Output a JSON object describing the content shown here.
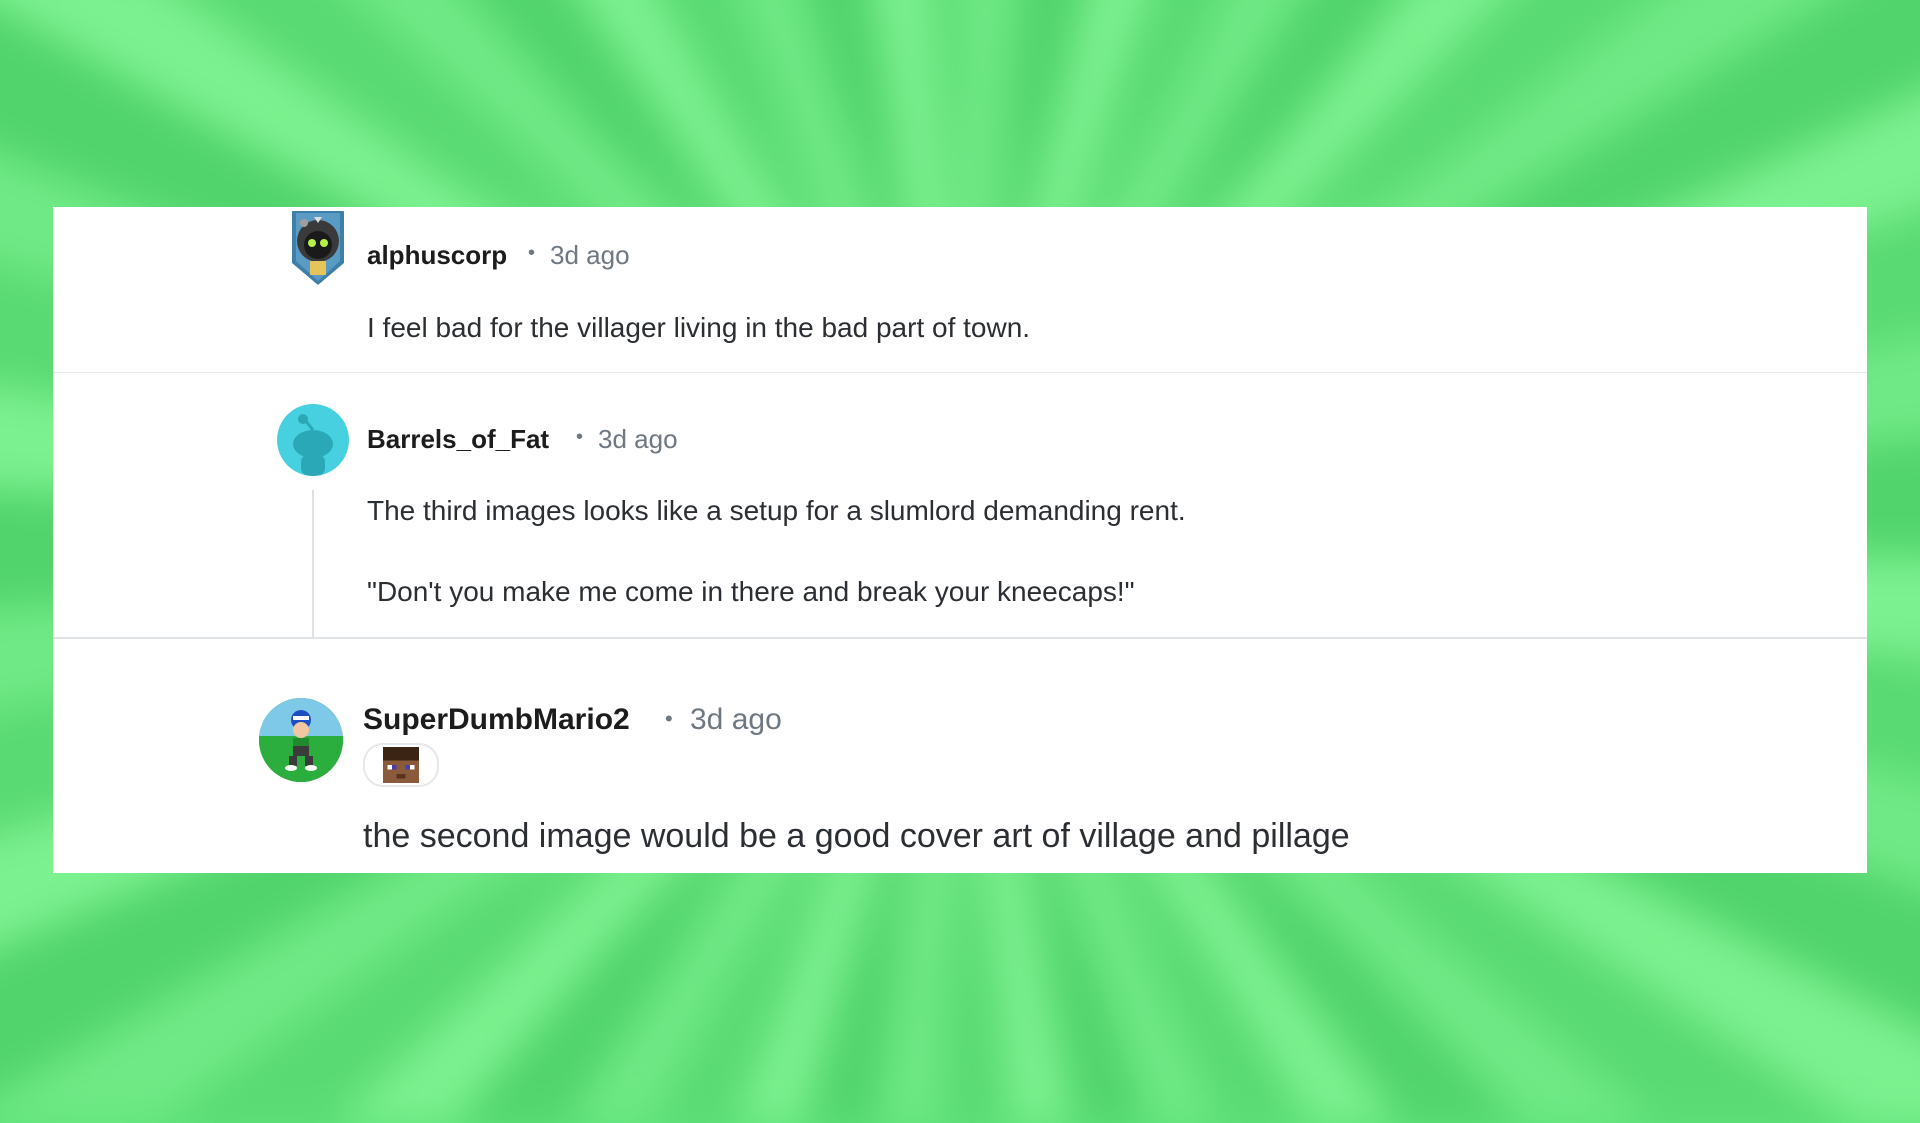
{
  "comments": [
    {
      "username": "alphuscorp",
      "separator": "•",
      "time": "3d ago",
      "avatar_icon": "hooded-character-avatar-icon",
      "body": [
        "I feel bad for the villager living in the bad part of town."
      ]
    },
    {
      "username": "Barrels_of_Fat",
      "separator": "•",
      "time": "3d ago",
      "avatar_icon": "snoo-avatar-icon",
      "body": [
        "The third images looks like a setup for a slumlord demanding rent.",
        "\"Don't you make me come in there and break your kneecaps!\""
      ]
    },
    {
      "username": "SuperDumbMario2",
      "separator": "•",
      "time": "3d ago",
      "avatar_icon": "mario-character-avatar-icon",
      "flair_icon": "minecraft-steve-flair-icon",
      "body": [
        "the second image would be a good cover art of village and pillage"
      ]
    }
  ],
  "colors": {
    "background": "#5fe27a",
    "card": "#ffffff",
    "username": "#1c1c1c",
    "meta": "#6f7780",
    "body_text": "#2b2f33",
    "snoo_avatar": "#46d0e0"
  }
}
